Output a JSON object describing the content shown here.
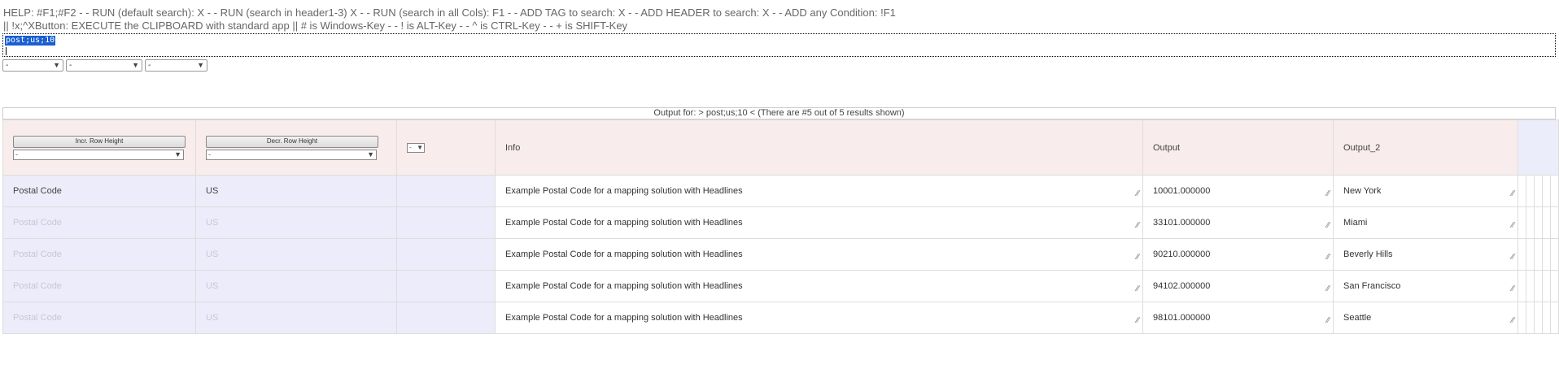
{
  "help": {
    "line1": "HELP: #F1;#F2 - - RUN (default search): X - - RUN (search in header1-3) X - - RUN (search in all Cols): F1 - - ADD TAG to search: X - - ADD HEADER to search: X - - ADD any Condition: !F1",
    "line2": "|| !x;^XButton: EXECUTE the CLIPBOARD with standard app || # is Windows-Key - - ! is ALT-Key - - ^ is CTRL-Key - - + is SHIFT-Key"
  },
  "query": {
    "value": "post;us;10"
  },
  "filters": [
    "-",
    "-",
    "-"
  ],
  "output_title": "Output for: > post;us;10 < (There are #5 out of 5 results shown)",
  "header": {
    "incr_label": "Incr. Row Height",
    "decr_label": "Decr. Row Height",
    "sel1": "-",
    "sel2": "-",
    "sel3": "-",
    "col_info": "Info",
    "col_output": "Output",
    "col_output2": "Output_2"
  },
  "rows": [
    {
      "type": "Postal Code",
      "country": "US",
      "info": "Example Postal Code for a mapping solution with Headlines",
      "output": "10001.000000",
      "output2": "New York"
    },
    {
      "type": "Postal Code",
      "country": "US",
      "info": "Example Postal Code for a mapping solution with Headlines",
      "output": "33101.000000",
      "output2": "Miami"
    },
    {
      "type": "Postal Code",
      "country": "US",
      "info": "Example Postal Code for a mapping solution with Headlines",
      "output": "90210.000000",
      "output2": "Beverly Hills"
    },
    {
      "type": "Postal Code",
      "country": "US",
      "info": "Example Postal Code for a mapping solution with Headlines",
      "output": "94102.000000",
      "output2": "San Francisco"
    },
    {
      "type": "Postal Code",
      "country": "US",
      "info": "Example Postal Code for a mapping solution with Headlines",
      "output": "98101.000000",
      "output2": "Seattle"
    }
  ]
}
